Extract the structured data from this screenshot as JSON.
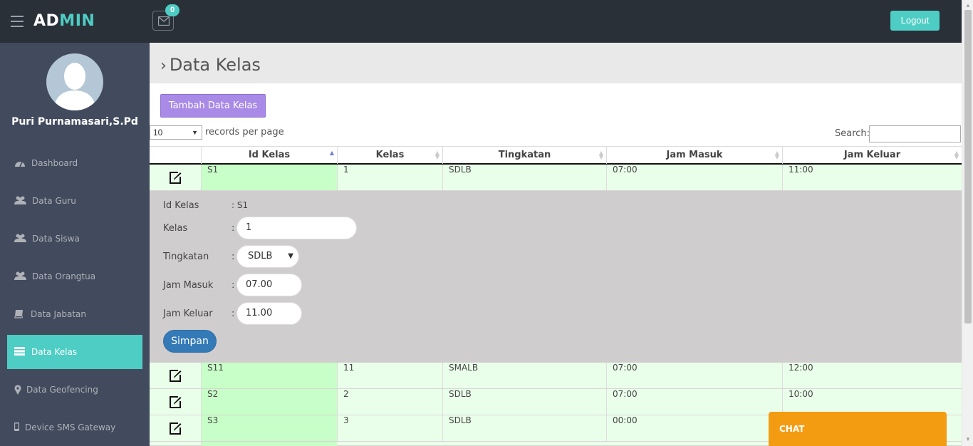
{
  "header": {
    "logo_part1": "AD",
    "logo_part2": "MIN",
    "mail_badge": "0",
    "logout_label": "Logout"
  },
  "sidebar": {
    "username": "Puri Purnamasari,S.Pd",
    "items": [
      {
        "label": "Dashboard",
        "icon": "dashboard-icon"
      },
      {
        "label": "Data Guru",
        "icon": "users-icon"
      },
      {
        "label": "Data Siswa",
        "icon": "users-icon"
      },
      {
        "label": "Data Orangtua",
        "icon": "users-icon"
      },
      {
        "label": "Data Jabatan",
        "icon": "book-icon"
      },
      {
        "label": "Data Kelas",
        "icon": "list-icon",
        "active": true
      },
      {
        "label": "Data Geofencing",
        "icon": "map-marker-icon"
      },
      {
        "label": "Device SMS Gateway",
        "icon": "mobile-icon"
      }
    ]
  },
  "main": {
    "page_title": "Data Kelas",
    "add_button": "Tambah Data Kelas",
    "page_length": "10",
    "page_length_label": "records per page",
    "search_label": "Search:",
    "search_value": ""
  },
  "table": {
    "columns": [
      "Id Kelas",
      "Kelas",
      "Tingkatan",
      "Jam Masuk",
      "Jam Keluar"
    ],
    "sorted_column": "Id Kelas",
    "rows": [
      {
        "id": "S1",
        "kelas": "1",
        "tingkatan": "SDLB",
        "jam_masuk": "07:00",
        "jam_keluar": "11:00"
      },
      {
        "id": "S11",
        "kelas": "11",
        "tingkatan": "SMALB",
        "jam_masuk": "07:00",
        "jam_keluar": "12:00"
      },
      {
        "id": "S2",
        "kelas": "2",
        "tingkatan": "SDLB",
        "jam_masuk": "07:00",
        "jam_keluar": "10:00"
      },
      {
        "id": "S3",
        "kelas": "3",
        "tingkatan": "SDLB",
        "jam_masuk": "00:00",
        "jam_keluar": ""
      }
    ]
  },
  "detail": {
    "id_label": "Id Kelas",
    "id_value": ": S1",
    "kelas_label": "Kelas",
    "kelas_value": "1",
    "tingkatan_label": "Tingkatan",
    "tingkatan_value": "SDLB",
    "jam_masuk_label": "Jam Masuk",
    "jam_masuk_value": "07.00",
    "jam_keluar_label": "Jam Keluar",
    "jam_keluar_value": "11.00",
    "colon": ":",
    "save_label": "Simpan"
  },
  "chat": {
    "label": "CHAT"
  },
  "colors": {
    "accent": "#4ecdc4",
    "header": "#2a3038",
    "sidebar": "#424a5d",
    "add_button": "#a98ae7",
    "save_button": "#337ab7",
    "chat": "#f39c12",
    "row": "#eaffea",
    "sorted_cell": "#c8ffc8"
  }
}
